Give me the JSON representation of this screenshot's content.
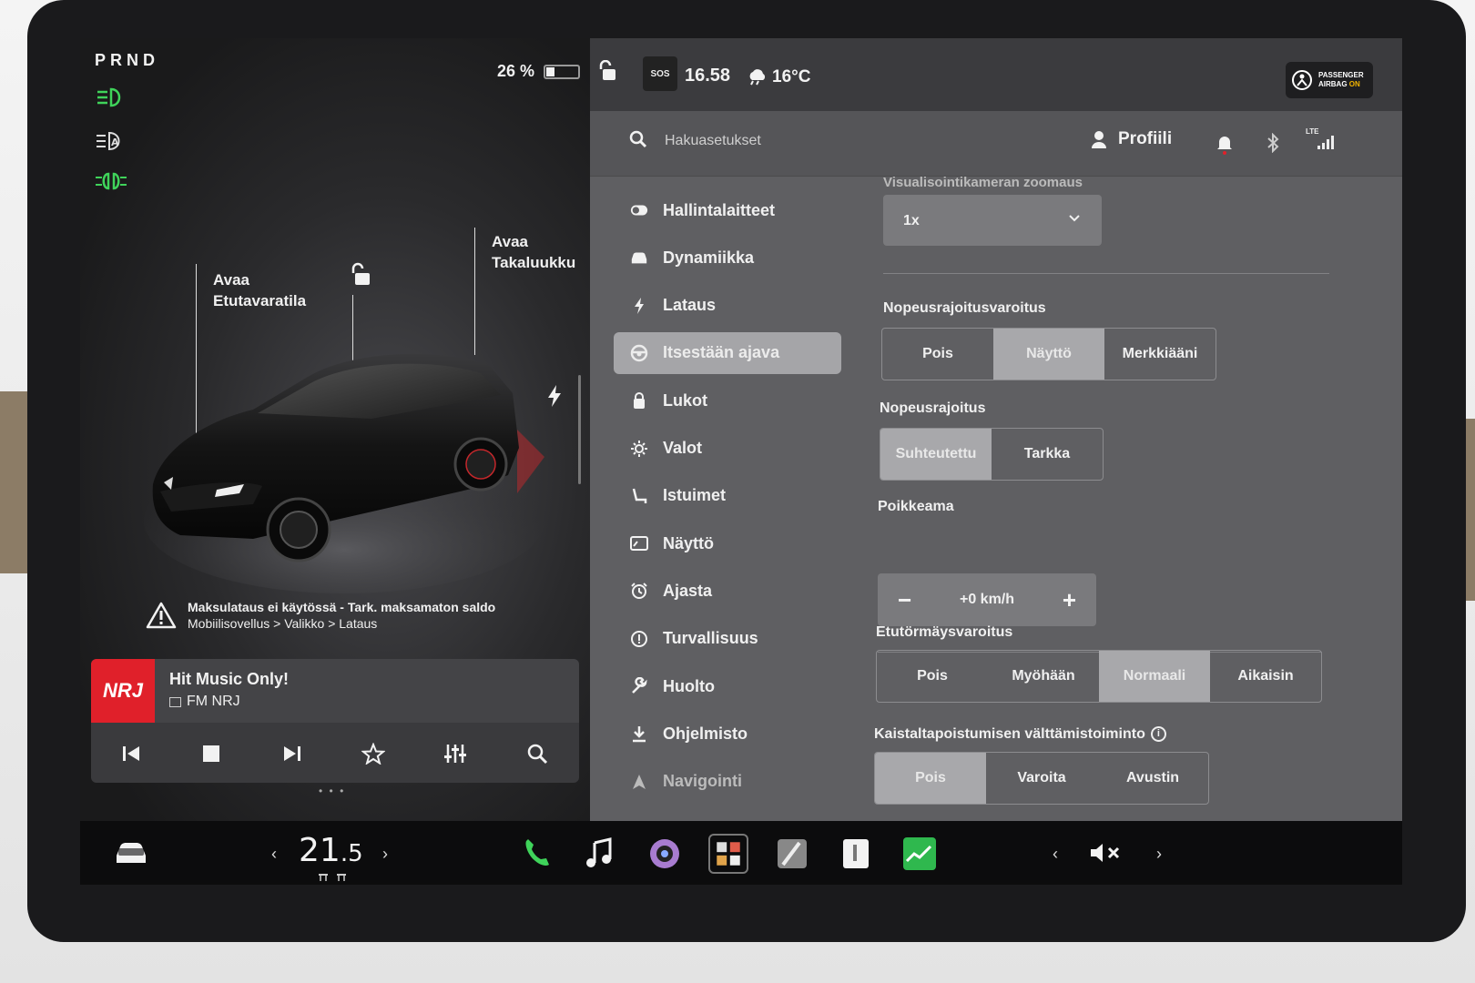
{
  "status": {
    "gear": "PRND",
    "battery_percent": "26 %",
    "battery_level": 0.26,
    "time": "16.58",
    "sos": "SOS",
    "outside_temp": "16°C",
    "airbag_line1": "PASSENGER",
    "airbag_line2": "AIRBAG",
    "airbag_state": "ON"
  },
  "car_view": {
    "open_front_trunk": [
      "Avaa",
      "Etutavaratila"
    ],
    "open_rear_trunk": [
      "Avaa",
      "Takaluukku"
    ],
    "alert_title": "Maksulataus ei käytössä - Tark. maksamaton saldo",
    "alert_subtitle": "Mobiilisovellus > Valikko > Lataus"
  },
  "media": {
    "logo": "NRJ",
    "station": "Hit Music Only!",
    "band": "FM NRJ",
    "dots": "• • •"
  },
  "top": {
    "search_placeholder": "Hakuasetukset",
    "profile_label": "Profiili",
    "lte": "LTE"
  },
  "nav": {
    "items": [
      {
        "label": "Hallintalaitteet",
        "icon": "toggle-icon"
      },
      {
        "label": "Dynamiikka",
        "icon": "car-icon"
      },
      {
        "label": "Lataus",
        "icon": "bolt-icon"
      },
      {
        "label": "Itsestään ajava",
        "icon": "steering-wheel-icon",
        "active": true
      },
      {
        "label": "Lukot",
        "icon": "lock-icon"
      },
      {
        "label": "Valot",
        "icon": "sun-icon"
      },
      {
        "label": "Istuimet",
        "icon": "seat-icon"
      },
      {
        "label": "Näyttö",
        "icon": "display-icon"
      },
      {
        "label": "Ajasta",
        "icon": "alarm-icon"
      },
      {
        "label": "Turvallisuus",
        "icon": "info-circle-icon"
      },
      {
        "label": "Huolto",
        "icon": "wrench-icon"
      },
      {
        "label": "Ohjelmisto",
        "icon": "download-icon"
      },
      {
        "label": "Navigointi",
        "icon": "navigation-icon"
      }
    ]
  },
  "settings": {
    "camera_zoom_title": "Visualisointikameran zoomaus",
    "camera_zoom_value": "1x",
    "speed_warning_title": "Nopeusrajoitusvaroitus",
    "speed_warning_options": [
      "Pois",
      "Näyttö",
      "Merkkiääni"
    ],
    "speed_warning_selected": 1,
    "speed_limit_title": "Nopeusrajoitus",
    "speed_limit_options": [
      "Suhteutettu",
      "Tarkka"
    ],
    "speed_limit_selected": 0,
    "offset_title": "Poikkeama",
    "offset_value": "+0 km/h",
    "minus": "−",
    "plus": "+",
    "collision_title": "Etutörmäysvaroitus",
    "collision_options": [
      "Pois",
      "Myöhään",
      "Normaali",
      "Aikaisin"
    ],
    "collision_selected": 2,
    "lane_title": "Kaistaltapoistumisen välttämistoiminto",
    "lane_options": [
      "Pois",
      "Varoita",
      "Avustin"
    ],
    "lane_selected": 0
  },
  "bottom": {
    "temp_int": "21",
    "temp_dec": ".5",
    "left_arrow": "‹",
    "right_arrow": "›"
  },
  "colors": {
    "accent_green": "#3fd35a",
    "nrj_red": "#e0202a",
    "airbag_on": "#f2b400"
  }
}
